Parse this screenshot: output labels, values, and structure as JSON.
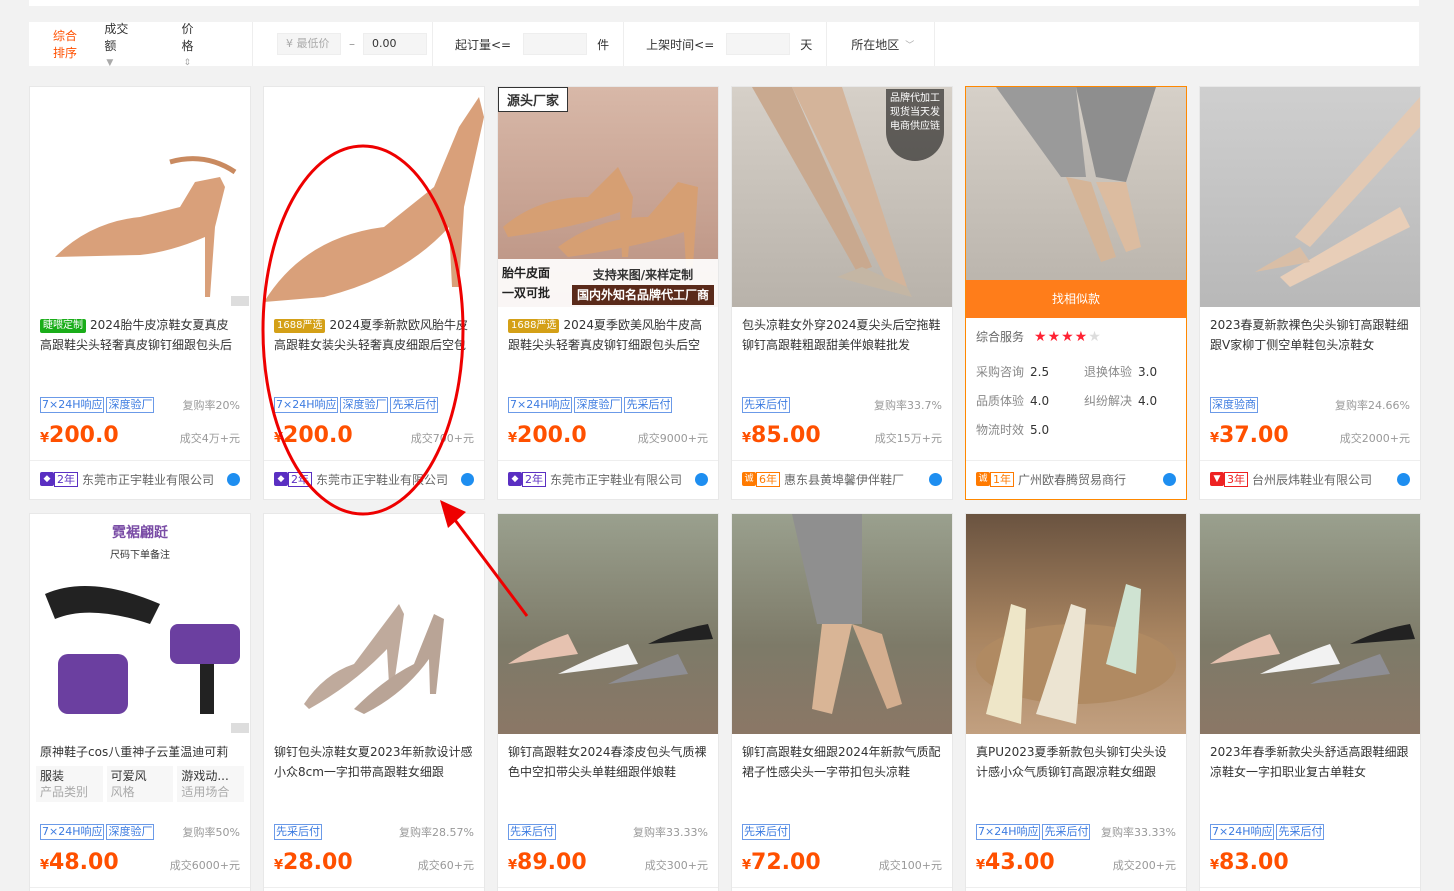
{
  "filter": {
    "sort_composite": "综合排序",
    "sort_volume": "成交额",
    "sort_price": "价格",
    "price_min_placeholder": "¥ 最低价",
    "price_dash": "–",
    "price_max": "0.00",
    "moq_label": "起订量<=",
    "moq_unit": "件",
    "listed_label": "上架时间<=",
    "listed_unit": "天",
    "region_label": "所在地区"
  },
  "find_similar": "找相似款",
  "service": {
    "overall": "综合服务",
    "stars": "★★★★",
    "stars_off": "★",
    "items": [
      {
        "k": "采购咨询",
        "v": "2.5"
      },
      {
        "k": "退换体验",
        "v": "3.0"
      },
      {
        "k": "品质体验",
        "v": "4.0"
      },
      {
        "k": "纠纷解决",
        "v": "4.0"
      },
      {
        "k": "物流时效",
        "v": "5.0"
      }
    ]
  },
  "overlays": {
    "c3_top": "源头厂家",
    "c3_bl1": "胎牛皮面",
    "c3_bl2": "一双可批",
    "c3_br1": "支持来图/来样定制",
    "c3_br2": "国内外知名品牌代工厂商",
    "c4_badge": "品牌代加工 现货当天发 电商供应链",
    "c7_title": "霓裾翩跹",
    "c7_sub": "尺码下单备注"
  },
  "products": [
    {
      "ptag": "睫喂定制",
      "title": "2024胎牛皮凉鞋女夏真皮高跟鞋尖头轻奢真皮铆钉细跟包头后",
      "tags": [
        "7×24H响应",
        "深度验厂"
      ],
      "repurchase": "复购率20%",
      "currency": "¥",
      "price": "200.0",
      "deal": "成交4万+元",
      "years": "2年",
      "shop": "东莞市正宇鞋业有限公司"
    },
    {
      "ptag": "1688严选",
      "title": "2024夏季新款欧风胎牛皮高跟鞋女装尖头轻奢真皮细跟后空包",
      "tags": [
        "7×24H响应",
        "深度验厂",
        "先采后付"
      ],
      "repurchase": "",
      "currency": "¥",
      "price": "200.0",
      "deal": "成交700+元",
      "years": "2年",
      "shop": "东莞市正宇鞋业有限公司"
    },
    {
      "ptag": "1688严选",
      "title": "2024夏季欧美风胎牛皮高跟鞋尖头轻奢真皮铆钉细跟包头后空",
      "tags": [
        "7×24H响应",
        "深度验厂",
        "先采后付"
      ],
      "repurchase": "",
      "currency": "¥",
      "price": "200.0",
      "deal": "成交9000+元",
      "years": "2年",
      "shop": "东莞市正宇鞋业有限公司"
    },
    {
      "ptag": "",
      "title": "包头凉鞋女外穿2024夏尖头后空拖鞋铆钉高跟鞋粗跟甜美伴娘鞋批发",
      "tags": [
        "先采后付"
      ],
      "repurchase": "复购率33.7%",
      "currency": "¥",
      "price": "85.00",
      "deal": "成交15万+元",
      "years": "6年",
      "shop": "惠东县黄埠馨伊伴鞋厂"
    },
    {
      "ptag": "",
      "title": "",
      "tags": [],
      "repurchase": "",
      "currency": "",
      "price": "",
      "deal": "",
      "years": "1年",
      "shop": "广州欧春腾贸易商行"
    },
    {
      "ptag": "",
      "title": "2023春夏新款裸色尖头铆钉高跟鞋细跟V家柳丁侧空单鞋包头凉鞋女",
      "tags": [
        "深度验商"
      ],
      "repurchase": "复购率24.66%",
      "currency": "¥",
      "price": "37.00",
      "deal": "成交2000+元",
      "years": "3年",
      "shop": "台州辰炜鞋业有限公司"
    },
    {
      "ptag": "",
      "title": "原神鞋子cos八重神子云堇温迪可莉胡",
      "attrs": [
        {
          "v": "服装",
          "k": "产品类别"
        },
        {
          "v": "可爱风",
          "k": "风格"
        },
        {
          "v": "游戏动...",
          "k": "适用场合"
        }
      ],
      "tags": [
        "7×24H响应",
        "深度验厂"
      ],
      "repurchase": "复购率50%",
      "currency": "¥",
      "price": "48.00",
      "deal": "成交6000+元"
    },
    {
      "ptag": "",
      "title": "铆钉包头凉鞋女夏2023年新款设计感小众8cm一字扣带高跟鞋女细跟",
      "tags": [
        "先采后付"
      ],
      "repurchase": "复购率28.57%",
      "currency": "¥",
      "price": "28.00",
      "deal": "成交60+元"
    },
    {
      "ptag": "",
      "title": "铆钉高跟鞋女2024春漆皮包头气质裸色中空扣带尖头单鞋细跟伴娘鞋",
      "tags": [
        "先采后付"
      ],
      "repurchase": "复购率33.33%",
      "currency": "¥",
      "price": "89.00",
      "deal": "成交300+元"
    },
    {
      "ptag": "",
      "title": "铆钉高跟鞋女细跟2024年新款气质配裙子性感尖头一字带扣包头凉鞋",
      "tags": [
        "先采后付"
      ],
      "repurchase": "",
      "currency": "¥",
      "price": "72.00",
      "deal": "成交100+元"
    },
    {
      "ptag": "",
      "title": "真PU2023夏季新款包头铆钉尖头设计感小众气质铆钉高跟凉鞋女细跟",
      "tags": [
        "7×24H响应",
        "先采后付"
      ],
      "repurchase": "复购率33.33%",
      "currency": "¥",
      "price": "43.00",
      "deal": "成交200+元"
    },
    {
      "ptag": "",
      "title": "2023年春季新款尖头舒适高跟鞋细跟凉鞋女一字扣职业复古单鞋女",
      "tags": [
        "7×24H响应",
        "先采后付"
      ],
      "repurchase": "",
      "currency": "¥",
      "price": "83.00",
      "deal": ""
    }
  ]
}
